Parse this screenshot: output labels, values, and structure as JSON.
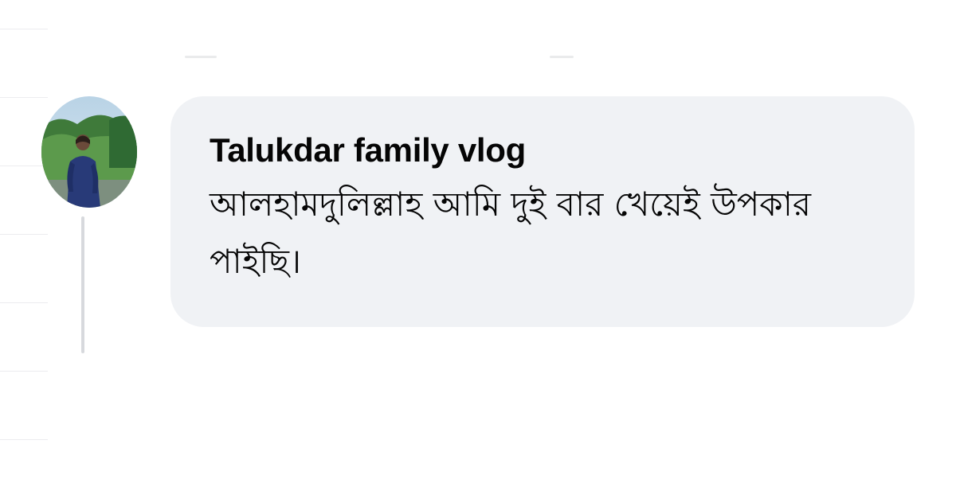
{
  "comment": {
    "author": "Talukdar family vlog",
    "text": "আলহামদুলিল্লাহ আমি দুই বার খেয়েই উপকার পাইছি।",
    "avatar": "profile-photo-avatar"
  },
  "colors": {
    "bubble_background": "#f0f2f5",
    "text": "#050505",
    "thread_line": "#d7d9dd",
    "page_background": "#ffffff"
  }
}
